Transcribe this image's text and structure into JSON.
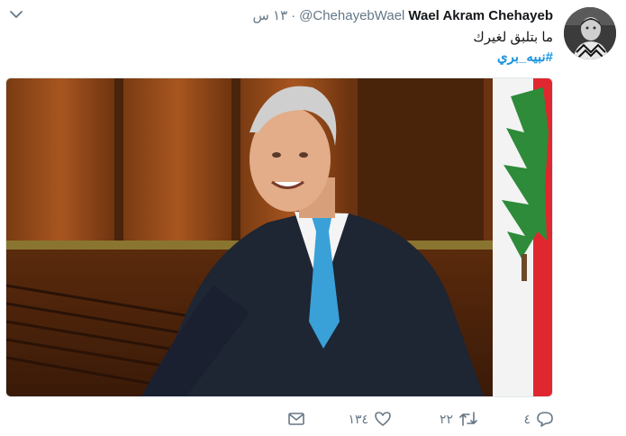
{
  "tweet": {
    "author_name": "Wael Akram Chehayeb",
    "handle": "@ChehayebWael",
    "separator": "·",
    "time": "١٣ س",
    "text": "ما بتلبق لغيرك",
    "hashtag": "#نبيه_بري"
  },
  "actions": {
    "reply_count": "٤",
    "retweet_count": "٢٢",
    "like_count": "١٣٤"
  },
  "colors": {
    "link": "#1b95e0",
    "muted": "#657786",
    "flag_red": "#e0272f",
    "flag_green": "#2e8b3a"
  },
  "icons": {
    "menu": "chevron-down-icon",
    "reply": "reply-icon",
    "retweet": "retweet-icon",
    "like": "heart-icon",
    "dm": "envelope-icon"
  }
}
